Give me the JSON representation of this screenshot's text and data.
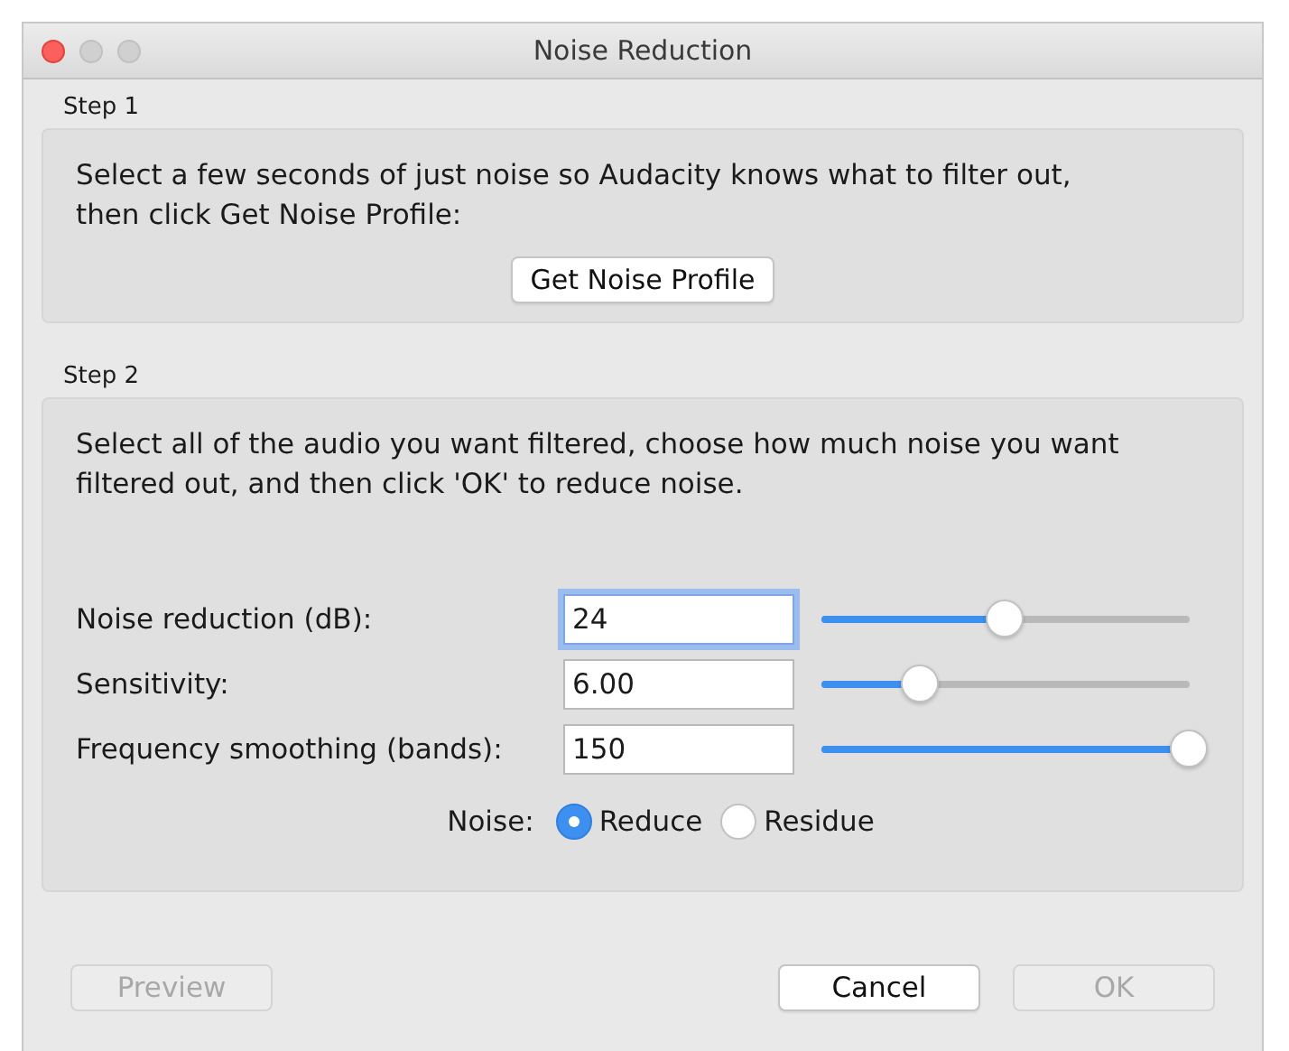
{
  "window": {
    "title": "Noise Reduction"
  },
  "step1": {
    "label": "Step 1",
    "text": "Select a few seconds of just noise so Audacity knows what to filter out, then click Get Noise Profile:",
    "button": "Get Noise Profile"
  },
  "step2": {
    "label": "Step 2",
    "text": "Select all of the audio you want filtered, choose how much noise you want filtered out, and then click 'OK' to reduce noise.",
    "settings": [
      {
        "label": "Noise reduction (dB):",
        "value": "24",
        "focused": true,
        "level": 0.5
      },
      {
        "label": "Sensitivity:",
        "value": "6.00",
        "focused": false,
        "level": 0.27
      },
      {
        "label": "Frequency smoothing (bands):",
        "value": "150",
        "focused": false,
        "level": 1.0
      }
    ],
    "noise": {
      "label": "Noise:",
      "options": [
        {
          "label": "Reduce",
          "selected": true
        },
        {
          "label": "Residue",
          "selected": false
        }
      ]
    }
  },
  "buttons": [
    {
      "label": "Preview",
      "disabled": true,
      "kind": "left"
    },
    {
      "label": "Cancel",
      "disabled": false,
      "kind": "right"
    },
    {
      "label": "OK",
      "disabled": true,
      "kind": "right"
    }
  ]
}
